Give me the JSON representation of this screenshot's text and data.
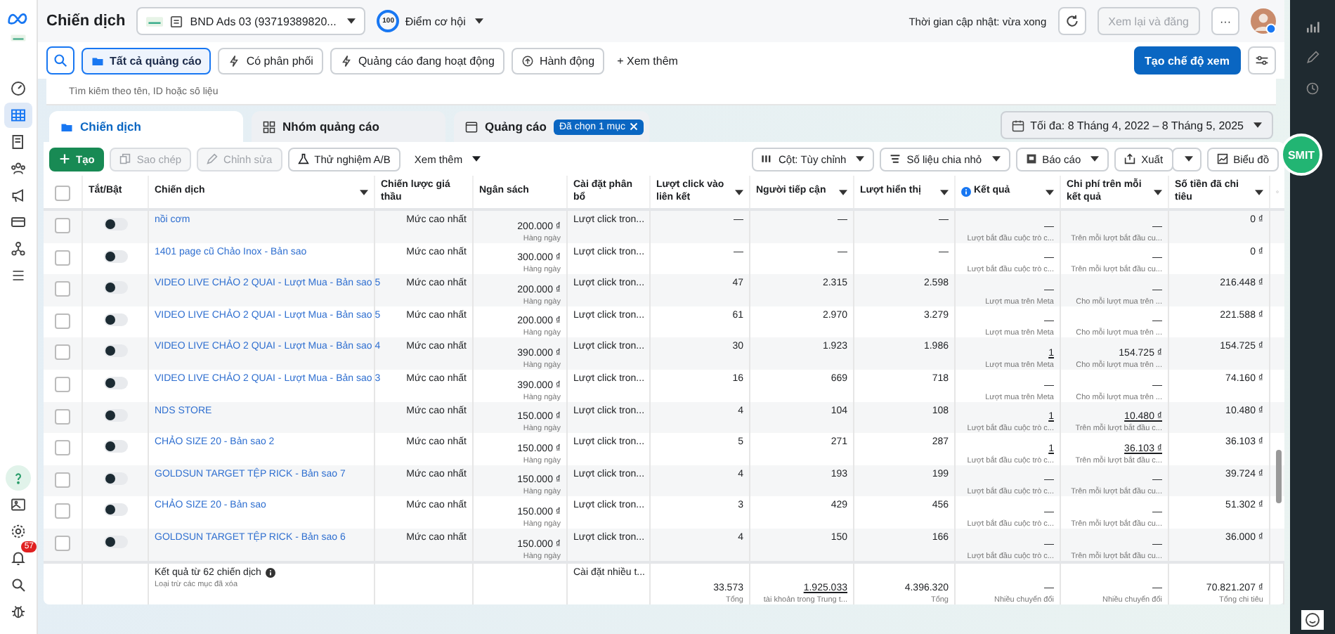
{
  "header": {
    "title": "Chiến dịch",
    "account": "BND Ads 03 (93719389820...",
    "score": "100",
    "score_label": "Điểm cơ hội",
    "updated": "Thời gian cập nhật: vừa xong",
    "review_button": "Xem lại và đăng",
    "review_disabled": true,
    "more_button": "···"
  },
  "sidebar": {
    "items": [
      {
        "kind": "gauge",
        "selected": false
      },
      {
        "kind": "table",
        "selected": true
      },
      {
        "kind": "book",
        "selected": false
      },
      {
        "kind": "people",
        "selected": false
      },
      {
        "kind": "megaphone",
        "selected": false
      },
      {
        "kind": "card",
        "selected": false
      },
      {
        "kind": "network",
        "selected": false
      },
      {
        "kind": "menu",
        "selected": false
      }
    ],
    "bottom": [
      {
        "kind": "help"
      },
      {
        "kind": "image"
      },
      {
        "kind": "gear"
      },
      {
        "kind": "bell",
        "badge": "57"
      },
      {
        "kind": "search"
      },
      {
        "kind": "bug"
      }
    ]
  },
  "filters": {
    "chips": [
      {
        "label": "Tất cả quảng cáo",
        "kind": "folder",
        "selected": true
      },
      {
        "label": "Có phân phối",
        "kind": "bolt",
        "selected": false
      },
      {
        "label": "Quảng cáo đang hoạt động",
        "kind": "bolt",
        "selected": false
      },
      {
        "label": "Hành động",
        "kind": "action",
        "selected": false
      }
    ],
    "more": "+ Xem thêm",
    "create_view": "Tạo chế độ xem"
  },
  "search": {
    "placeholder": "Tìm kiếm theo tên, ID hoặc số liệu"
  },
  "tabs": [
    {
      "label": "Chiến dịch",
      "kind": "folder",
      "selected": true
    },
    {
      "label": "Nhóm quảng cáo",
      "kind": "grid",
      "selected": false
    },
    {
      "label": "Quảng cáo",
      "kind": "ad",
      "selected": false,
      "chip": "Đã chọn 1 mục"
    }
  ],
  "date_range": "Tối đa: 8 Tháng 4, 2022 – 8 Tháng 5, 2025",
  "toolbar": {
    "left": [
      {
        "label": "Tạo",
        "kind": "create",
        "disabled": false
      },
      {
        "label": "Sao chép",
        "kind": "copy",
        "disabled": true
      },
      {
        "label": "Chỉnh sửa",
        "kind": "edit",
        "disabled": true
      },
      {
        "label": "Thử nghiệm A/B",
        "kind": "flask",
        "disabled": false
      },
      {
        "label": "Xem thêm",
        "kind": "more",
        "disabled": false
      }
    ],
    "right": [
      {
        "label": "Cột: Tùy chỉnh",
        "kind": "columns"
      },
      {
        "label": "Số liệu chia nhỏ",
        "kind": "breakdown"
      },
      {
        "label": "Báo cáo",
        "kind": "report"
      },
      {
        "label": "Xuất",
        "kind": "export"
      },
      {
        "label": "Biểu đồ",
        "kind": "chart"
      }
    ]
  },
  "table": {
    "select_all_checked": false,
    "columns": [
      {
        "label": "Tắt/Bật",
        "caret": false,
        "info": false
      },
      {
        "label": "Chiến dịch",
        "caret": true,
        "info": false
      },
      {
        "label": "Chiến lược giá thầu",
        "caret": false,
        "info": false
      },
      {
        "label": "Ngân sách",
        "caret": false,
        "info": false
      },
      {
        "label": "Cài đặt phân bổ",
        "caret": false,
        "info": false
      },
      {
        "label": "Lượt click vào liên kết",
        "caret": true,
        "info": false
      },
      {
        "label": "Người tiếp cận",
        "caret": true,
        "info": false
      },
      {
        "label": "Lượt hiển thị",
        "caret": true,
        "info": false
      },
      {
        "label": "Kết quả",
        "caret": true,
        "info": true
      },
      {
        "label": "Chi phí trên mỗi kết quả",
        "caret": true,
        "info": false
      },
      {
        "label": "Số tiền đã chi tiêu",
        "caret": true,
        "info": false
      }
    ],
    "rows": [
      {
        "checked": false,
        "on": false,
        "name": "nồi cơm",
        "bid": "Mức cao nhất",
        "budget": "200.000 ₫",
        "budget_sub": "Hàng ngày",
        "attribution": "Lượt click tron...",
        "clicks": "—",
        "reach": "—",
        "impressions": "—",
        "result": "—",
        "result_link": false,
        "result_sub": "Lượt bắt đầu cuộc trò c...",
        "cost": "—",
        "cost_link": false,
        "cost_sub": "Trên mỗi lượt bắt đầu cu...",
        "spent": "0 ₫"
      },
      {
        "checked": false,
        "on": false,
        "name": "1401 page cũ Chảo Inox - Bản sao",
        "bid": "Mức cao nhất",
        "budget": "300.000 ₫",
        "budget_sub": "Hàng ngày",
        "attribution": "Lượt click tron...",
        "clicks": "—",
        "reach": "—",
        "impressions": "—",
        "result": "—",
        "result_link": false,
        "result_sub": "Lượt bắt đầu cuộc trò c...",
        "cost": "—",
        "cost_link": false,
        "cost_sub": "Trên mỗi lượt bắt đầu cu...",
        "spent": "0 ₫"
      },
      {
        "checked": false,
        "on": false,
        "name": "VIDEO LIVE CHẢO 2 QUAI - Lượt Mua - Bản sao 5",
        "bid": "Mức cao nhất",
        "budget": "200.000 ₫",
        "budget_sub": "Hàng ngày",
        "attribution": "Lượt click tron...",
        "clicks": "47",
        "reach": "2.315",
        "impressions": "2.598",
        "result": "—",
        "result_link": false,
        "result_sub": "Lượt mua trên Meta",
        "cost": "—",
        "cost_link": false,
        "cost_sub": "Cho mỗi lượt mua trên ...",
        "spent": "216.448 ₫"
      },
      {
        "checked": false,
        "on": false,
        "name": "VIDEO LIVE CHẢO 2 QUAI - Lượt Mua - Bản sao 5",
        "bid": "Mức cao nhất",
        "budget": "200.000 ₫",
        "budget_sub": "Hàng ngày",
        "attribution": "Lượt click tron...",
        "clicks": "61",
        "reach": "2.970",
        "impressions": "3.279",
        "result": "—",
        "result_link": false,
        "result_sub": "Lượt mua trên Meta",
        "cost": "—",
        "cost_link": false,
        "cost_sub": "Cho mỗi lượt mua trên ...",
        "spent": "221.588 ₫"
      },
      {
        "checked": false,
        "on": false,
        "name": "VIDEO LIVE CHẢO 2 QUAI - Lượt Mua - Bản sao 4",
        "bid": "Mức cao nhất",
        "budget": "390.000 ₫",
        "budget_sub": "Hàng ngày",
        "attribution": "Lượt click tron...",
        "clicks": "30",
        "reach": "1.923",
        "impressions": "1.986",
        "result": "1",
        "result_link": true,
        "result_sub": "Lượt mua trên Meta",
        "cost": "154.725 ₫",
        "cost_link": false,
        "cost_sub": "Cho mỗi lượt mua trên ...",
        "spent": "154.725 ₫"
      },
      {
        "checked": false,
        "on": false,
        "name": "VIDEO LIVE CHẢO 2 QUAI - Lượt Mua - Bản sao 3",
        "bid": "Mức cao nhất",
        "budget": "390.000 ₫",
        "budget_sub": "Hàng ngày",
        "attribution": "Lượt click tron...",
        "clicks": "16",
        "reach": "669",
        "impressions": "718",
        "result": "—",
        "result_link": false,
        "result_sub": "Lượt mua trên Meta",
        "cost": "—",
        "cost_link": false,
        "cost_sub": "Cho mỗi lượt mua trên ...",
        "spent": "74.160 ₫"
      },
      {
        "checked": false,
        "on": false,
        "name": "NDS STORE",
        "bid": "Mức cao nhất",
        "budget": "150.000 ₫",
        "budget_sub": "Hàng ngày",
        "attribution": "Lượt click tron...",
        "clicks": "4",
        "reach": "104",
        "impressions": "108",
        "result": "1",
        "result_link": true,
        "result_sub": "Lượt bắt đầu cuộc trò c...",
        "cost": "10.480 ₫",
        "cost_link": true,
        "cost_sub": "Trên mỗi lượt bắt đầu c...",
        "spent": "10.480 ₫"
      },
      {
        "checked": false,
        "on": false,
        "name": "CHẢO SIZE 20 - Bản sao 2",
        "bid": "Mức cao nhất",
        "budget": "150.000 ₫",
        "budget_sub": "Hàng ngày",
        "attribution": "Lượt click tron...",
        "clicks": "5",
        "reach": "271",
        "impressions": "287",
        "result": "1",
        "result_link": true,
        "result_sub": "Lượt bắt đầu cuộc trò c...",
        "cost": "36.103 ₫",
        "cost_link": true,
        "cost_sub": "Trên mỗi lượt bắt đầu c...",
        "spent": "36.103 ₫"
      },
      {
        "checked": false,
        "on": false,
        "name": "GOLDSUN TARGET TỆP RICK - Bản sao 7",
        "bid": "Mức cao nhất",
        "budget": "150.000 ₫",
        "budget_sub": "Hàng ngày",
        "attribution": "Lượt click tron...",
        "clicks": "4",
        "reach": "193",
        "impressions": "199",
        "result": "—",
        "result_link": false,
        "result_sub": "Lượt bắt đầu cuộc trò c...",
        "cost": "—",
        "cost_link": false,
        "cost_sub": "Trên mỗi lượt bắt đầu cu...",
        "spent": "39.724 ₫"
      },
      {
        "checked": false,
        "on": false,
        "name": "CHẢO SIZE 20 - Bản sao",
        "bid": "Mức cao nhất",
        "budget": "150.000 ₫",
        "budget_sub": "Hàng ngày",
        "attribution": "Lượt click tron...",
        "clicks": "3",
        "reach": "429",
        "impressions": "456",
        "result": "—",
        "result_link": false,
        "result_sub": "Lượt bắt đầu cuộc trò c...",
        "cost": "—",
        "cost_link": false,
        "cost_sub": "Trên mỗi lượt bắt đầu cu...",
        "spent": "51.302 ₫"
      },
      {
        "checked": false,
        "on": false,
        "name": "GOLDSUN TARGET TỆP RICK - Bản sao 6",
        "bid": "Mức cao nhất",
        "budget": "150.000 ₫",
        "budget_sub": "Hàng ngày",
        "attribution": "Lượt click tron...",
        "clicks": "4",
        "reach": "150",
        "impressions": "166",
        "result": "—",
        "result_link": false,
        "result_sub": "Lượt bắt đầu cuộc trò c...",
        "cost": "—",
        "cost_link": false,
        "cost_sub": "Trên mỗi lượt bắt đầu cu...",
        "spent": "36.000 ₫"
      }
    ],
    "footer": {
      "title": "Kết quả từ 62 chiến dịch",
      "note": "Loại trừ các mục đã xóa",
      "attribution": "Cài đặt nhiều t...",
      "clicks": "33.573",
      "clicks_sub": "Tổng",
      "reach": "1.925.033",
      "reach_sub": "tài khoản trong Trung t...",
      "impressions": "4.396.320",
      "impressions_sub": "Tổng",
      "result": "—",
      "result_sub": "Nhiều chuyển đổi",
      "cost": "—",
      "cost_sub": "Nhiều chuyển đổi",
      "spent": "70.821.207 ₫",
      "spent_sub": "Tổng chi tiêu"
    }
  },
  "smit_badge": "SMIT"
}
